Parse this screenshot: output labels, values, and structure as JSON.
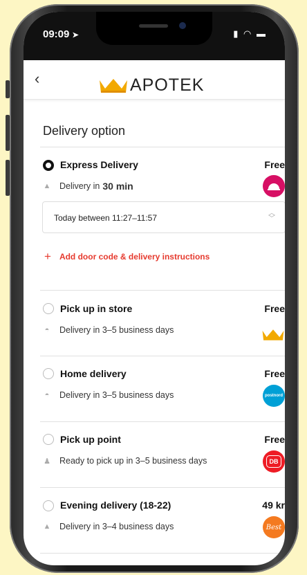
{
  "status_bar": {
    "time": "09:09",
    "location_icon": "location-arrow-icon",
    "signal_icon": "signal-icon",
    "wifi_icon": "wifi-icon",
    "battery_icon": "battery-icon"
  },
  "header": {
    "back_icon": "chevron-left-icon",
    "logo_text": "APOTEK",
    "logo_icon": "crown-icon"
  },
  "section_title": "Delivery option",
  "options": [
    {
      "title": "Express Delivery",
      "price": "Free",
      "selected": true,
      "sub_prefix": "Delivery in",
      "sub_bold": "30 min",
      "icon": "store-icon",
      "carrier": "Foodora",
      "carrier_color": "#d70f64"
    },
    {
      "title": "Pick up in store",
      "price": "Free",
      "selected": false,
      "sub": "Delivery in 3–5 business days",
      "icon": "car-icon",
      "carrier": "Apotek",
      "carrier_color": "#f2a900"
    },
    {
      "title": "Home delivery",
      "price": "Free",
      "selected": false,
      "sub": "Delivery in 3–5 business days",
      "icon": "car-icon",
      "carrier": "postnord",
      "carrier_color": "#00a0d6"
    },
    {
      "title": "Pick up point",
      "price": "Free",
      "selected": false,
      "sub": "Ready to pick up in 3–5 business days",
      "icon": "person-icon",
      "carrier": "DB",
      "carrier_color": "#ee1c25"
    },
    {
      "title": "Evening delivery (18-22)",
      "price": "49 kr",
      "selected": false,
      "sub": "Delivery in 3–4 business days",
      "icon": "store-icon",
      "carrier": "Best",
      "carrier_color": "#f47a20"
    }
  ],
  "time_select": {
    "value": "Today between 11:27–11:57",
    "icon": "up-down-chevron-icon"
  },
  "add_instructions": {
    "label": "Add door code & delivery instructions",
    "icon": "plus-icon"
  },
  "colors": {
    "accent_red": "#e63a2e",
    "crown_gold": "#f2a900",
    "background": "#fdf6c4"
  }
}
